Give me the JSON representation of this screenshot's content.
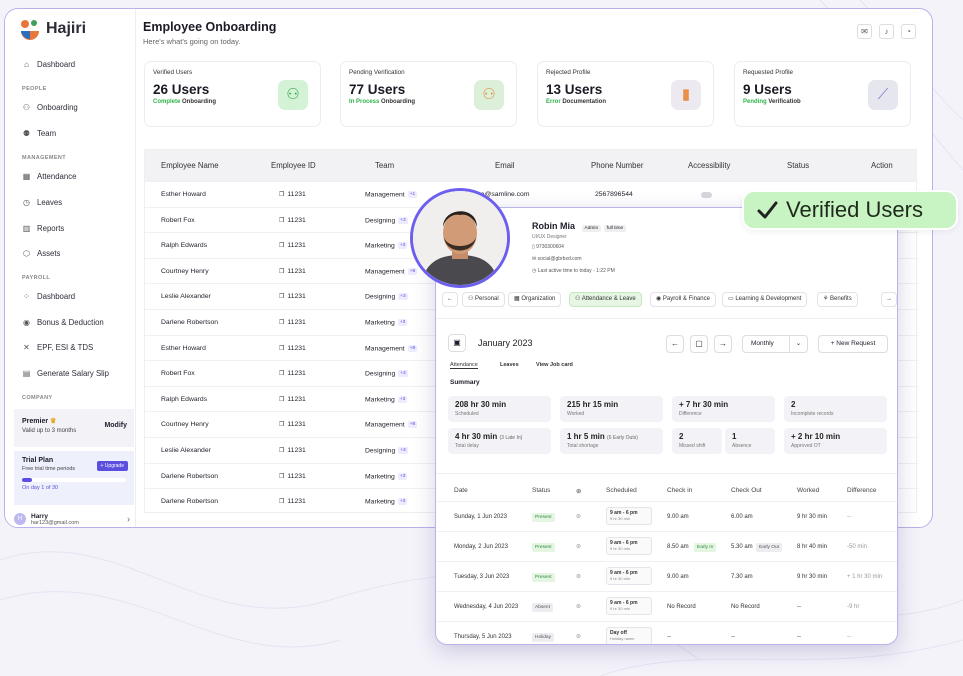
{
  "app": {
    "name": "Hajiri"
  },
  "sidebar": {
    "dashboard": "Dashboard",
    "sec_people": "PEOPLE",
    "onboarding": "Onboarding",
    "team": "Team",
    "sec_management": "MANAGEMENT",
    "attendance": "Attendance",
    "leaves": "Leaves",
    "reports": "Reports",
    "assets": "Assets",
    "sec_payroll": "PAYROLL",
    "pay_dashboard": "Dashboard",
    "bonus": "Bonus & Deduction",
    "epf": "EPF, ESI & TDS",
    "salary": "Generate Salary Slip",
    "sec_company": "COMPANY",
    "premier": {
      "title": "Premier",
      "validity": "Valid up to 3 months",
      "action": "Modify"
    },
    "trial": {
      "title": "Trial Plan",
      "desc": "Free trial time periods",
      "upgrade": "+ Upgrade",
      "progress": 0.1,
      "day": "On day 1 of 30"
    },
    "user": {
      "initial": "H",
      "name": "Harry",
      "email": "har123@gmail.com"
    }
  },
  "header": {
    "title": "Employee Onboarding",
    "subtitle": "Here's what's going on today."
  },
  "cards": [
    {
      "title": "Verified Users",
      "value": "26 Users",
      "status": "Complete",
      "suffix": "Onboarding",
      "color": "#2fb34a"
    },
    {
      "title": "Pending Verification",
      "value": "77 Users",
      "status": "In Process",
      "suffix": "Onboarding",
      "color": "#2fb34a"
    },
    {
      "title": "Rejected Profile",
      "value": "13 Users",
      "status": "Error",
      "suffix": "Documentation",
      "color": "#2fb34a"
    },
    {
      "title": "Requested Profile",
      "value": "9 Users",
      "status": "Pending",
      "suffix": "Verificatiob",
      "color": "#2fb34a"
    }
  ],
  "table": {
    "headers": [
      "Employee Name",
      "Employee ID",
      "Team",
      "Email",
      "Phone Number",
      "Accessibility",
      "Status",
      "Action"
    ],
    "rows": [
      {
        "name": "Esther Howard",
        "id": "11231",
        "team": "Management",
        "badge": "+1",
        "email": "the@samline.com",
        "phone": "2567896544"
      },
      {
        "name": "Robert Fox",
        "id": "11231",
        "team": "Designing",
        "badge": "+3"
      },
      {
        "name": "Ralph Edwards",
        "id": "11231",
        "team": "Marketing",
        "badge": "+3"
      },
      {
        "name": "Courtney Henry",
        "id": "11231",
        "team": "Management",
        "badge": "+8"
      },
      {
        "name": "Leslie Alexander",
        "id": "11231",
        "team": "Designing",
        "badge": "+3"
      },
      {
        "name": "Darlene Robertson",
        "id": "11231",
        "team": "Marketing",
        "badge": "+3"
      },
      {
        "name": "Esther Howard",
        "id": "11231",
        "team": "Management",
        "badge": "+8"
      },
      {
        "name": "Robert Fox",
        "id": "11231",
        "team": "Designing",
        "badge": "+3"
      },
      {
        "name": "Ralph Edwards",
        "id": "11231",
        "team": "Marketing",
        "badge": "+3"
      },
      {
        "name": "Courtney Henry",
        "id": "11231",
        "team": "Management",
        "badge": "+8"
      },
      {
        "name": "Leslie Alexander",
        "id": "11231",
        "team": "Designing",
        "badge": "+3"
      },
      {
        "name": "Darlene Robertson",
        "id": "11231",
        "team": "Marketing",
        "badge": "+3"
      },
      {
        "name": "Darlene Robertson",
        "id": "11231",
        "team": "Marketing",
        "badge": "+3"
      }
    ]
  },
  "verified_badge": "Verified Users",
  "profile": {
    "name": "Robin Mia",
    "tag1": "Admin",
    "tag2": "full time",
    "role": "UI/UX Designer",
    "phone": "9730300604",
    "email": "social@gbrbxd.com",
    "active": "Last active time to today - 1:22 PM",
    "tabs": [
      "Personal",
      "Organization",
      "Attendance & Leave",
      "Payroll & Finance",
      "Learning & Development",
      "Benefits"
    ],
    "month": "January 2023",
    "view": "Monthly",
    "new_request": "+ New Request",
    "subtabs": [
      "Attendance",
      "Leaves",
      "View Job card"
    ],
    "summary_label": "Summary",
    "summary": [
      {
        "v": "208 hr 30 min",
        "n": "",
        "l": "Scheduled"
      },
      {
        "v": "215 hr 15 min",
        "n": "",
        "l": "Worked"
      },
      {
        "v": "+ 7 hr 30 min",
        "n": "",
        "l": "Difference"
      },
      {
        "v": "2",
        "n": "",
        "l": "Incomplete records"
      },
      {
        "v": "4 hr 30 min",
        "n": "(3 Late In)",
        "l": "Total delay"
      },
      {
        "v": "1 hr 5 min",
        "n": "(6 Early Outs)",
        "l": "Total shortage"
      },
      {
        "v": "2",
        "n": "",
        "l": "Missed shift"
      },
      {
        "v": "1",
        "n": "",
        "l": "Absence"
      },
      {
        "v": "+ 2 hr 10 min",
        "n": "",
        "l": "Approved OT"
      }
    ],
    "att_headers": [
      "Date",
      "Status",
      "",
      "Scheduled",
      "Check in",
      "Check Out",
      "Worked",
      "Difference"
    ],
    "att_rows": [
      {
        "date": "Sunday, 1 Jun 2023",
        "status": "Present",
        "s1": "9 am - 6 pm",
        "s2": "9 hr  30 min",
        "in": "9.00 am",
        "in_tag": "",
        "out": "6.00 am",
        "out_tag": "",
        "worked": "9 hr 30 min",
        "diff": "--"
      },
      {
        "date": "Monday, 2 Jun 2023",
        "status": "Present",
        "s1": "9 am - 6 pm",
        "s2": "9 hr  30 min",
        "in": "8.50 am",
        "in_tag": "Early In",
        "out": "5.30 am",
        "out_tag": "Early Out",
        "worked": "8 hr 40 min",
        "diff": "-50 min"
      },
      {
        "date": "Tuesday, 3 Jun 2023",
        "status": "Present",
        "s1": "9 am - 6 pm",
        "s2": "9 hr  30 min",
        "in": "9.00 am",
        "in_tag": "",
        "out": "7.30 am",
        "out_tag": "",
        "worked": "9 hr 30 min",
        "diff": "+ 1 hr 30 min"
      },
      {
        "date": "Wednesday, 4 Jun 2023",
        "status": "Absent",
        "s1": "9 am - 6 pm",
        "s2": "9 hr  30 min",
        "in": "No Record",
        "in_tag": "",
        "out": "No Record",
        "out_tag": "",
        "worked": "--",
        "diff": "-9 hr"
      },
      {
        "date": "Thursday, 5 Jun 2023",
        "status": "Holiday",
        "s1": "Day off",
        "s2": "Holiday name",
        "in": "--",
        "in_tag": "",
        "out": "--",
        "out_tag": "",
        "worked": "--",
        "diff": "--"
      }
    ]
  },
  "colors": {
    "accent": "#5b4fe0",
    "green": "#2fb34a",
    "border": "#b7b2ea"
  }
}
